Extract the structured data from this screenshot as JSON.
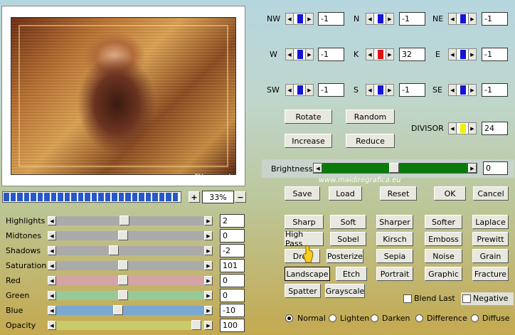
{
  "preview": {
    "zoom_value": "33%",
    "plus": "+",
    "minus": "−",
    "watermark_name": "Pinuccia",
    "watermark_url": "www.maidiregrafica.eu"
  },
  "kernel": {
    "nw": {
      "label": "NW",
      "value": "-1"
    },
    "n": {
      "label": "N",
      "value": "-1"
    },
    "ne": {
      "label": "NE",
      "value": "-1"
    },
    "w": {
      "label": "W",
      "value": "-1"
    },
    "k": {
      "label": "K",
      "value": "32"
    },
    "e": {
      "label": "E",
      "value": "-1"
    },
    "sw": {
      "label": "SW",
      "value": "-1"
    },
    "s": {
      "label": "S",
      "value": "-1"
    },
    "se": {
      "label": "SE",
      "value": "-1"
    }
  },
  "actions": {
    "rotate": "Rotate",
    "random": "Random",
    "increase": "Increase",
    "reduce": "Reduce"
  },
  "divisor": {
    "label": "DIVISOR",
    "value": "24"
  },
  "brightness": {
    "label": "Brightness",
    "value": "0"
  },
  "dialog": {
    "save": "Save",
    "load": "Load",
    "reset": "Reset",
    "ok": "OK",
    "cancel": "Cancel"
  },
  "adjust": [
    {
      "label": "Highlights",
      "value": "2",
      "color": "#aaaaaa",
      "pos": 0.46
    },
    {
      "label": "Midtones",
      "value": "0",
      "color": "#aaaaaa",
      "pos": 0.45
    },
    {
      "label": "Shadows",
      "value": "-2",
      "color": "#aaaaaa",
      "pos": 0.38
    },
    {
      "label": "Saturation",
      "value": "101",
      "color": "#aaaaaa",
      "pos": 0.45
    },
    {
      "label": "Red",
      "value": "0",
      "color": "#d4a4a4",
      "pos": 0.45
    },
    {
      "label": "Green",
      "value": "0",
      "color": "#98c998",
      "pos": 0.45
    },
    {
      "label": "Blue",
      "value": "-10",
      "color": "#7aa8d0",
      "pos": 0.41
    },
    {
      "label": "Opacity",
      "value": "100",
      "color": "#c9cb6a",
      "pos": 0.98
    }
  ],
  "presets": {
    "sharp": "Sharp",
    "soft": "Soft",
    "sharper": "Sharper",
    "softer": "Softer",
    "laplace": "Laplace",
    "highpass": "High Pass",
    "sobel": "Sobel",
    "kirsch": "Kirsch",
    "emboss": "Emboss",
    "prewitt": "Prewitt",
    "drop": "Drop",
    "posterize": "Posterize",
    "sepia": "Sepia",
    "noise": "Noise",
    "grain": "Grain",
    "landscape": "Landscape",
    "etch": "Etch",
    "portrait": "Portrait",
    "graphic": "Graphic",
    "fracture": "Fracture",
    "spatter": "Spatter",
    "grayscale": "Grayscale"
  },
  "options": {
    "blend_last": "Blend Last",
    "negative": "Negative"
  },
  "modes": {
    "normal": "Normal",
    "lighten": "Lighten",
    "darken": "Darken",
    "difference": "Difference",
    "diffuse": "Diffuse",
    "selected": "normal"
  }
}
